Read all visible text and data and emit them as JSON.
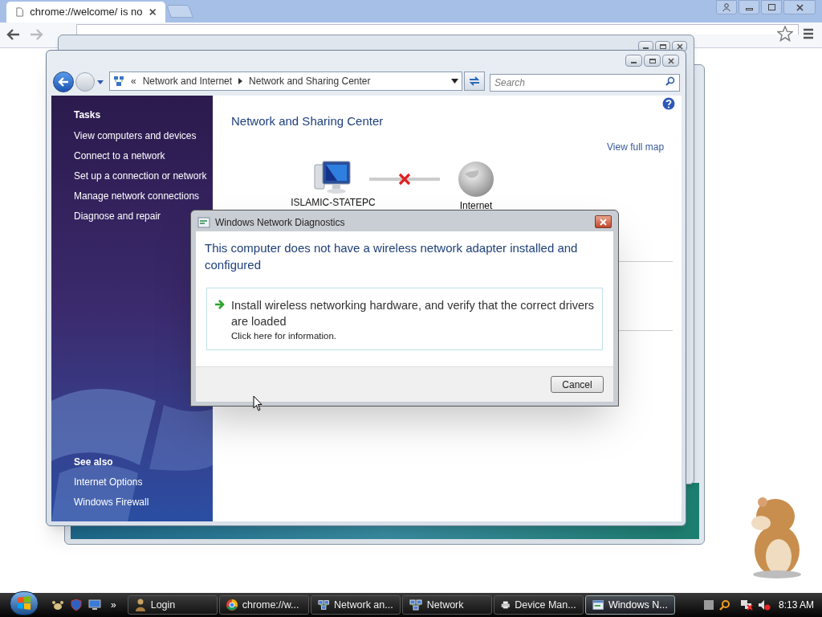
{
  "browser": {
    "tab_title": "chrome://welcome/ is no"
  },
  "explorer": {
    "breadcrumb": [
      "Network and Internet",
      "Network and Sharing Center"
    ],
    "breadcrumb_prefix": "«",
    "search": {
      "placeholder": "Search"
    },
    "sidebar": {
      "tasks_heading": "Tasks",
      "tasks": [
        "View computers and devices",
        "Connect to a network",
        "Set up a connection or network",
        "Manage network connections",
        "Diagnose and repair"
      ],
      "see_also_heading": "See also",
      "see_also": [
        "Internet Options",
        "Windows Firewall"
      ]
    },
    "title": "Network and Sharing Center",
    "view_full_map": "View full map",
    "map": {
      "nodes": [
        {
          "label": "ISLAMIC-STATEPC",
          "kind": "computer"
        },
        {
          "label": "Internet",
          "kind": "globe"
        }
      ],
      "connected": false
    }
  },
  "dialog": {
    "title": "Windows Network Diagnostics",
    "message": "This computer does not have a wireless network adapter installed and configured",
    "option": {
      "text": "Install wireless networking hardware, and verify that the correct drivers are loaded",
      "subtext": "Click here for information."
    },
    "cancel": "Cancel"
  },
  "taskbar": {
    "overflow": "»",
    "tasks": [
      {
        "label": "Login",
        "kind": "user",
        "selected": false
      },
      {
        "label": "chrome://w...",
        "kind": "chrome",
        "selected": false
      },
      {
        "label": "Network an...",
        "kind": "network",
        "selected": false
      },
      {
        "label": "Network",
        "kind": "network",
        "selected": false
      },
      {
        "label": "Device Man...",
        "kind": "device",
        "selected": false
      },
      {
        "label": "Windows N...",
        "kind": "window",
        "selected": true
      }
    ],
    "clock": "8:13 AM"
  }
}
